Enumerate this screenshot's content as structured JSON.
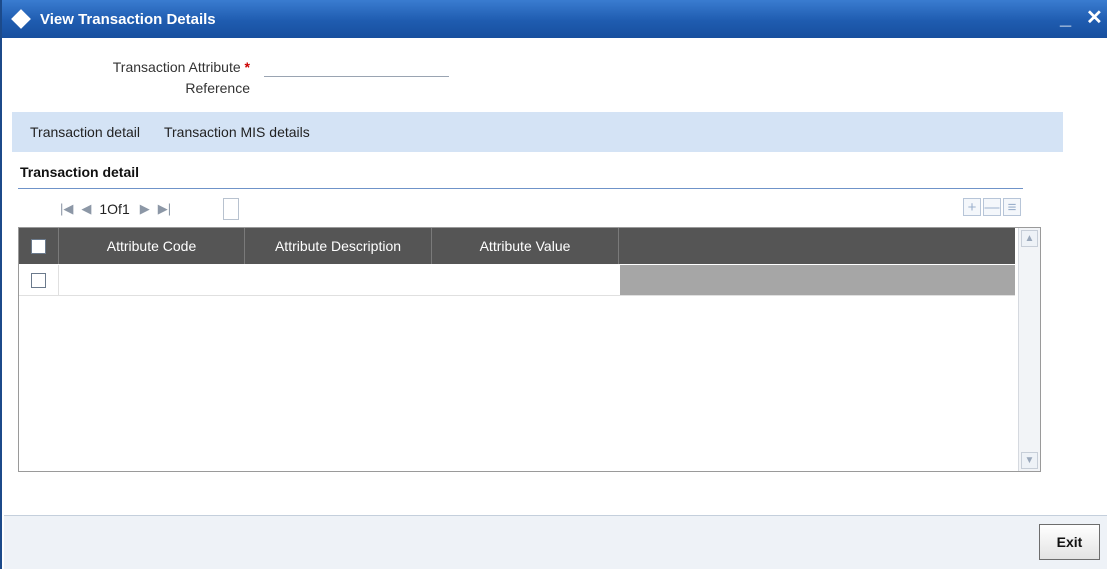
{
  "window": {
    "title": "View Transaction Details",
    "minimize_glyph": "_",
    "close_glyph": "✕"
  },
  "header": {
    "field_label_line1": "Transaction Attribute",
    "field_label_line2": "Reference",
    "required_mark": "*",
    "field_value": "",
    "field_placeholder": ""
  },
  "tabs": [
    {
      "label": "Transaction detail"
    },
    {
      "label": "Transaction MIS details"
    }
  ],
  "section": {
    "title": "Transaction detail"
  },
  "pager": {
    "first_icon": "first-page-icon",
    "prev_icon": "previous-page-icon",
    "next_icon": "next-page-icon",
    "last_icon": "last-page-icon",
    "count_text": "1Of1",
    "page_input_value": ""
  },
  "grid_tools": {
    "add_icon": "plus-icon",
    "delete_icon": "minus-icon",
    "single_view_icon": "list-view-icon"
  },
  "grid": {
    "columns": [
      "Attribute Code",
      "Attribute Description",
      "Attribute Value"
    ],
    "rows": [
      {
        "attribute_code": "",
        "attribute_description": "",
        "attribute_value": ""
      }
    ]
  },
  "footer": {
    "exit_label": "Exit"
  }
}
